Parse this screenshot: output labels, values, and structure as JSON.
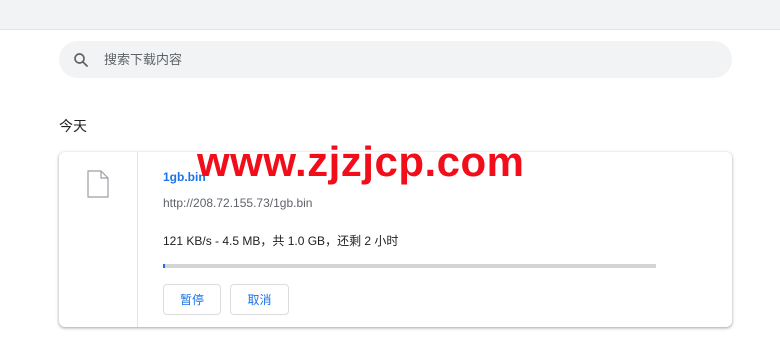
{
  "search": {
    "placeholder": "搜索下载内容"
  },
  "section": {
    "title": "今天"
  },
  "download": {
    "filename": "1gb.bin",
    "url": "http://208.72.155.73/1gb.bin",
    "status": "121 KB/s - 4.5 MB，共 1.0 GB，还剩 2 小时",
    "progress_percent": 0.45,
    "pause_label": "暂停",
    "cancel_label": "取消"
  },
  "overlay": {
    "watermark": "www.zjzjcp.com"
  },
  "colors": {
    "accent": "#1a73e8",
    "watermark": "#f20d1a",
    "search_bg": "#f1f3f4"
  }
}
